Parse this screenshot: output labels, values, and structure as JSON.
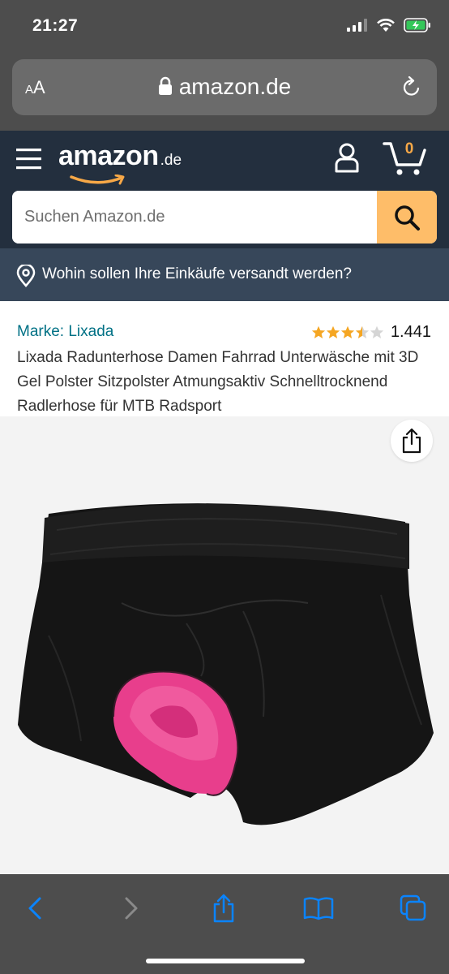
{
  "status_bar": {
    "time": "21:27"
  },
  "safari": {
    "aa_label_small": "A",
    "aa_label_large": "A",
    "url": "amazon.de"
  },
  "amazon": {
    "logo_text": "amazon",
    "logo_tld": ".de",
    "cart_count": "0",
    "search_placeholder": "Suchen Amazon.de",
    "deliver_text": "Wohin sollen Ihre Einkäufe versandt werden?"
  },
  "product": {
    "brand": "Marke: Lixada",
    "rating_stars": 3.5,
    "rating_count": "1.441",
    "title": "Lixada Radunterhose Damen Fahrrad Unterwäsche mit 3D Gel Polster Sitzpolster Atmungsaktiv Schnelltrocknend Radlerhose für MTB Radsport"
  },
  "colors": {
    "safari_chrome": "#4d4d4d",
    "amazon_header": "#232f3e",
    "deliver_bar": "#37475a",
    "search_button": "#febd69",
    "brand_link": "#007185",
    "star": "#f5a623",
    "toolbar_icon": "#0a84ff",
    "padding_pink": "#e83e8c"
  },
  "icons": [
    "signal-icon",
    "wifi-icon",
    "battery-icon",
    "lock-icon",
    "reload-icon",
    "menu-icon",
    "account-icon",
    "cart-icon",
    "search-icon",
    "location-pin-icon",
    "share-icon",
    "back-icon",
    "forward-icon",
    "toolbar-share-icon",
    "bookmarks-icon",
    "tabs-icon"
  ]
}
